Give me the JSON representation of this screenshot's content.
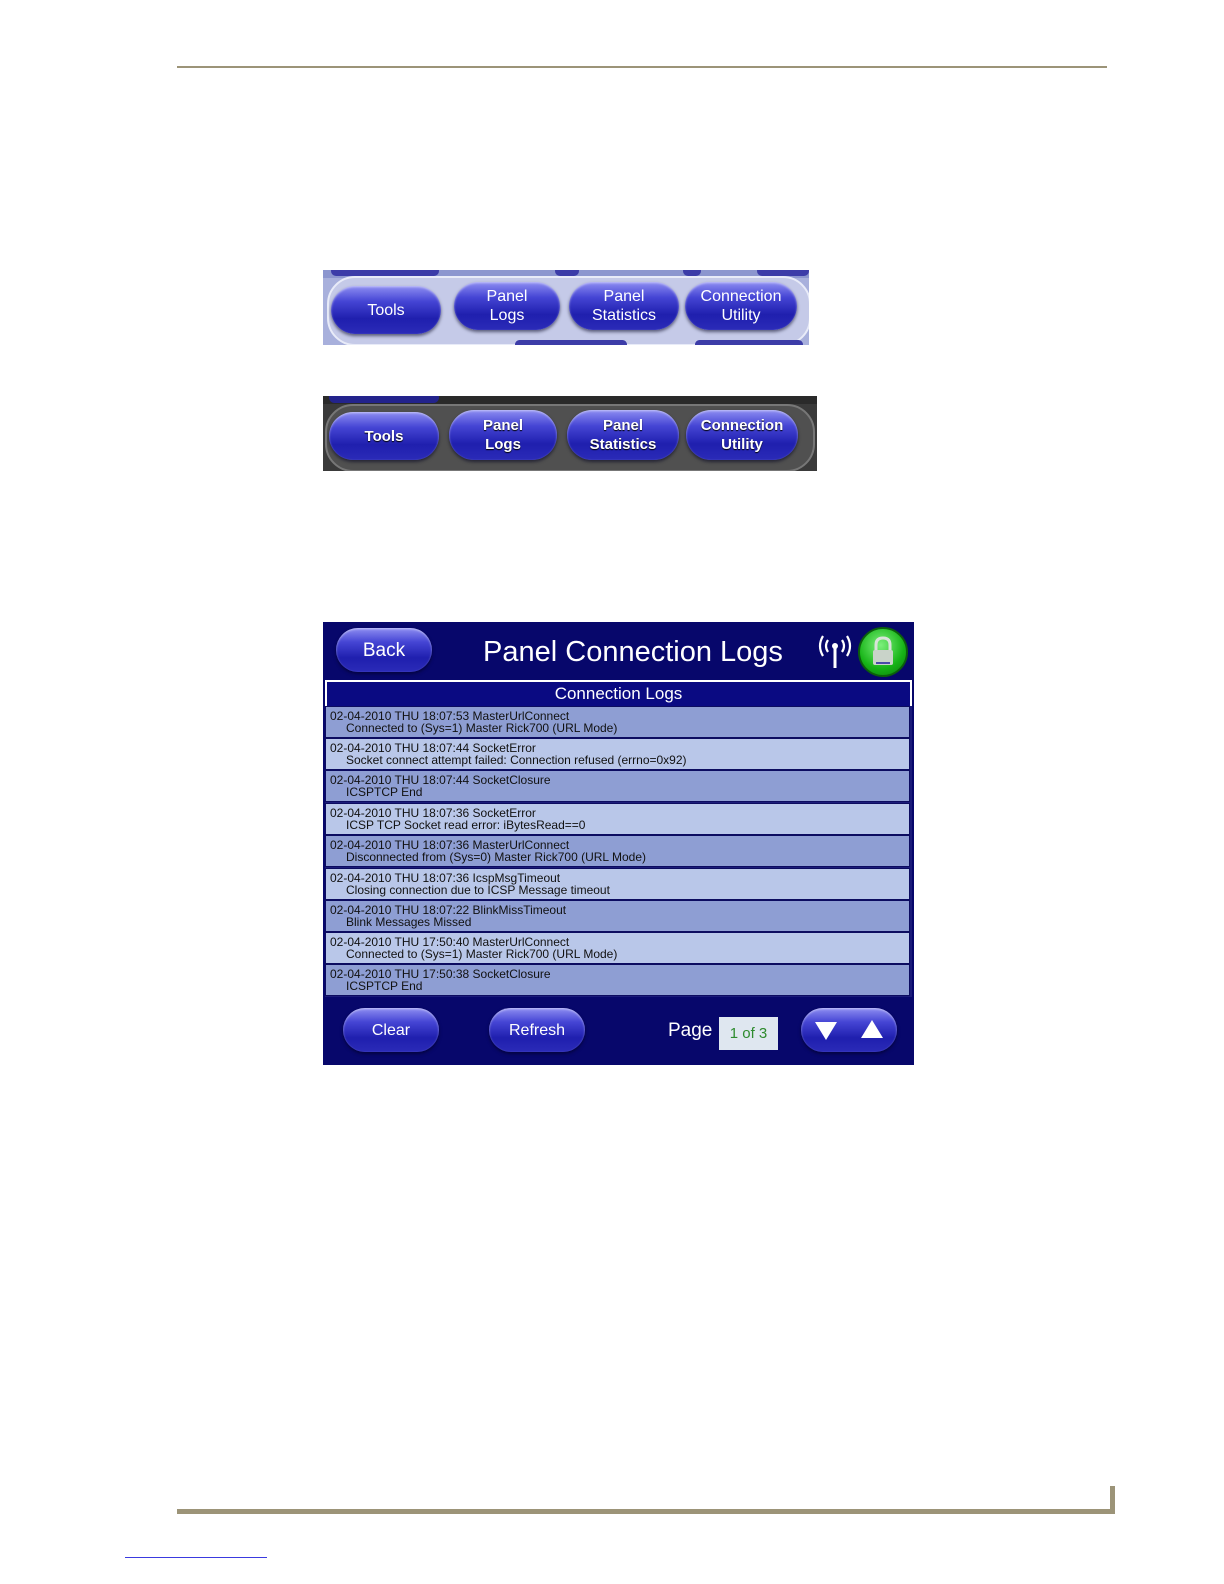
{
  "toolbar_light": {
    "tools": "Tools",
    "panel_logs": [
      "Panel",
      "Logs"
    ],
    "panel_statistics": [
      "Panel",
      "Statistics"
    ],
    "connection_utility": [
      "Connection",
      "Utility"
    ]
  },
  "toolbar_dark": {
    "tools": "Tools",
    "panel_logs": [
      "Panel",
      "Logs"
    ],
    "panel_statistics": [
      "Panel",
      "Statistics"
    ],
    "connection_utility": [
      "Connection",
      "Utility"
    ]
  },
  "panel": {
    "back_label": "Back",
    "title": "Panel Connection Logs",
    "logs_header": "Connection Logs",
    "logs": [
      {
        "line1": "02-04-2010 THU 18:07:53 MasterUrlConnect",
        "line2": "Connected to (Sys=1) Master Rick700 (URL Mode)"
      },
      {
        "line1": "02-04-2010 THU 18:07:44 SocketError",
        "line2": "Socket connect attempt failed: Connection refused (errno=0x92)"
      },
      {
        "line1": "02-04-2010 THU 18:07:44 SocketClosure",
        "line2": "ICSPTCP End"
      },
      {
        "line1": "02-04-2010 THU 18:07:36 SocketError",
        "line2": "ICSP TCP Socket read error: iBytesRead==0"
      },
      {
        "line1": "02-04-2010 THU 18:07:36 MasterUrlConnect",
        "line2": "Disconnected from (Sys=0) Master Rick700 (URL Mode)"
      },
      {
        "line1": "02-04-2010 THU 18:07:36 IcspMsgTimeout",
        "line2": "Closing connection due to ICSP Message timeout"
      },
      {
        "line1": "02-04-2010 THU 18:07:22 BlinkMissTimeout",
        "line2": "Blink Messages Missed"
      },
      {
        "line1": "02-04-2010 THU 17:50:40 MasterUrlConnect",
        "line2": "Connected to (Sys=1) Master Rick700 (URL Mode)"
      },
      {
        "line1": "02-04-2010 THU 17:50:38 SocketClosure",
        "line2": "ICSPTCP End"
      }
    ],
    "clear_label": "Clear",
    "refresh_label": "Refresh",
    "page_label": "Page",
    "page_value": "1 of 3",
    "icons": [
      "wifi-signal-icon",
      "lock-icon",
      "arrow-down-icon",
      "arrow-up-icon"
    ]
  },
  "colors": {
    "panel_bg": "#07076b",
    "button_blue": "#2b2bb8",
    "row_odd": "#8e9ed3",
    "row_even": "#b9c7e9",
    "page_value_text": "#2e8b2e",
    "lock_green": "#16b316",
    "rule": "#9c9478"
  }
}
